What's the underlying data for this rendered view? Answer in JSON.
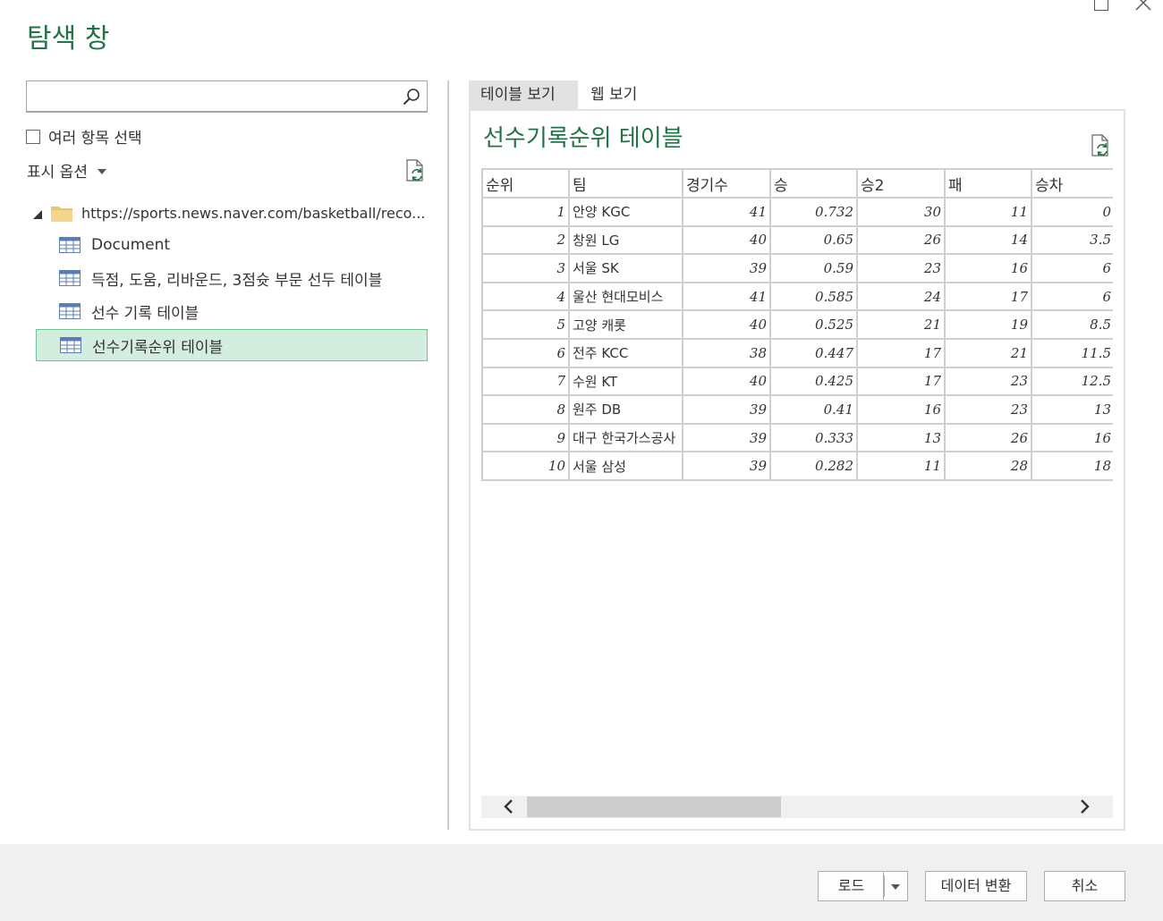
{
  "window": {
    "title": "탐색 창"
  },
  "search": {
    "value": "",
    "placeholder": ""
  },
  "multi_select": {
    "label": "여러 항목 선택",
    "checked": false
  },
  "display_options": {
    "label": "표시 옵션"
  },
  "tree": {
    "root": {
      "label": "https://sports.news.naver.com/basketball/reco..."
    },
    "items": [
      {
        "label": "Document"
      },
      {
        "label": "득점, 도움, 리바운드, 3점슛 부문 선두 테이블"
      },
      {
        "label": "선수 기록 테이블"
      },
      {
        "label": "선수기록순위 테이블",
        "selected": true
      }
    ]
  },
  "tabs": [
    {
      "label": "테이블 보기",
      "active": true
    },
    {
      "label": "웹 보기",
      "active": false
    }
  ],
  "preview": {
    "title": "선수기록순위 테이블",
    "columns": [
      "순위",
      "팀",
      "경기수",
      "승",
      "승2",
      "패",
      "승차"
    ],
    "rows": [
      [
        "1",
        "안양 KGC",
        "41",
        "0.732",
        "30",
        "11",
        "0"
      ],
      [
        "2",
        "창원 LG",
        "40",
        "0.65",
        "26",
        "14",
        "3.5"
      ],
      [
        "3",
        "서울 SK",
        "39",
        "0.59",
        "23",
        "16",
        "6"
      ],
      [
        "4",
        "울산 현대모비스",
        "41",
        "0.585",
        "24",
        "17",
        "6"
      ],
      [
        "5",
        "고양 캐롯",
        "40",
        "0.525",
        "21",
        "19",
        "8.5"
      ],
      [
        "6",
        "전주 KCC",
        "38",
        "0.447",
        "17",
        "21",
        "11.5"
      ],
      [
        "7",
        "수원 KT",
        "40",
        "0.425",
        "17",
        "23",
        "12.5"
      ],
      [
        "8",
        "원주 DB",
        "39",
        "0.41",
        "16",
        "23",
        "13"
      ],
      [
        "9",
        "대구 한국가스공사",
        "39",
        "0.333",
        "13",
        "26",
        "16"
      ],
      [
        "10",
        "서울 삼성",
        "39",
        "0.282",
        "11",
        "28",
        "18"
      ]
    ]
  },
  "buttons": {
    "load": "로드",
    "transform": "데이터 변환",
    "cancel": "취소"
  },
  "colors": {
    "accent": "#217346",
    "selection_bg": "#d3eddf",
    "selection_border": "#6cc491"
  }
}
